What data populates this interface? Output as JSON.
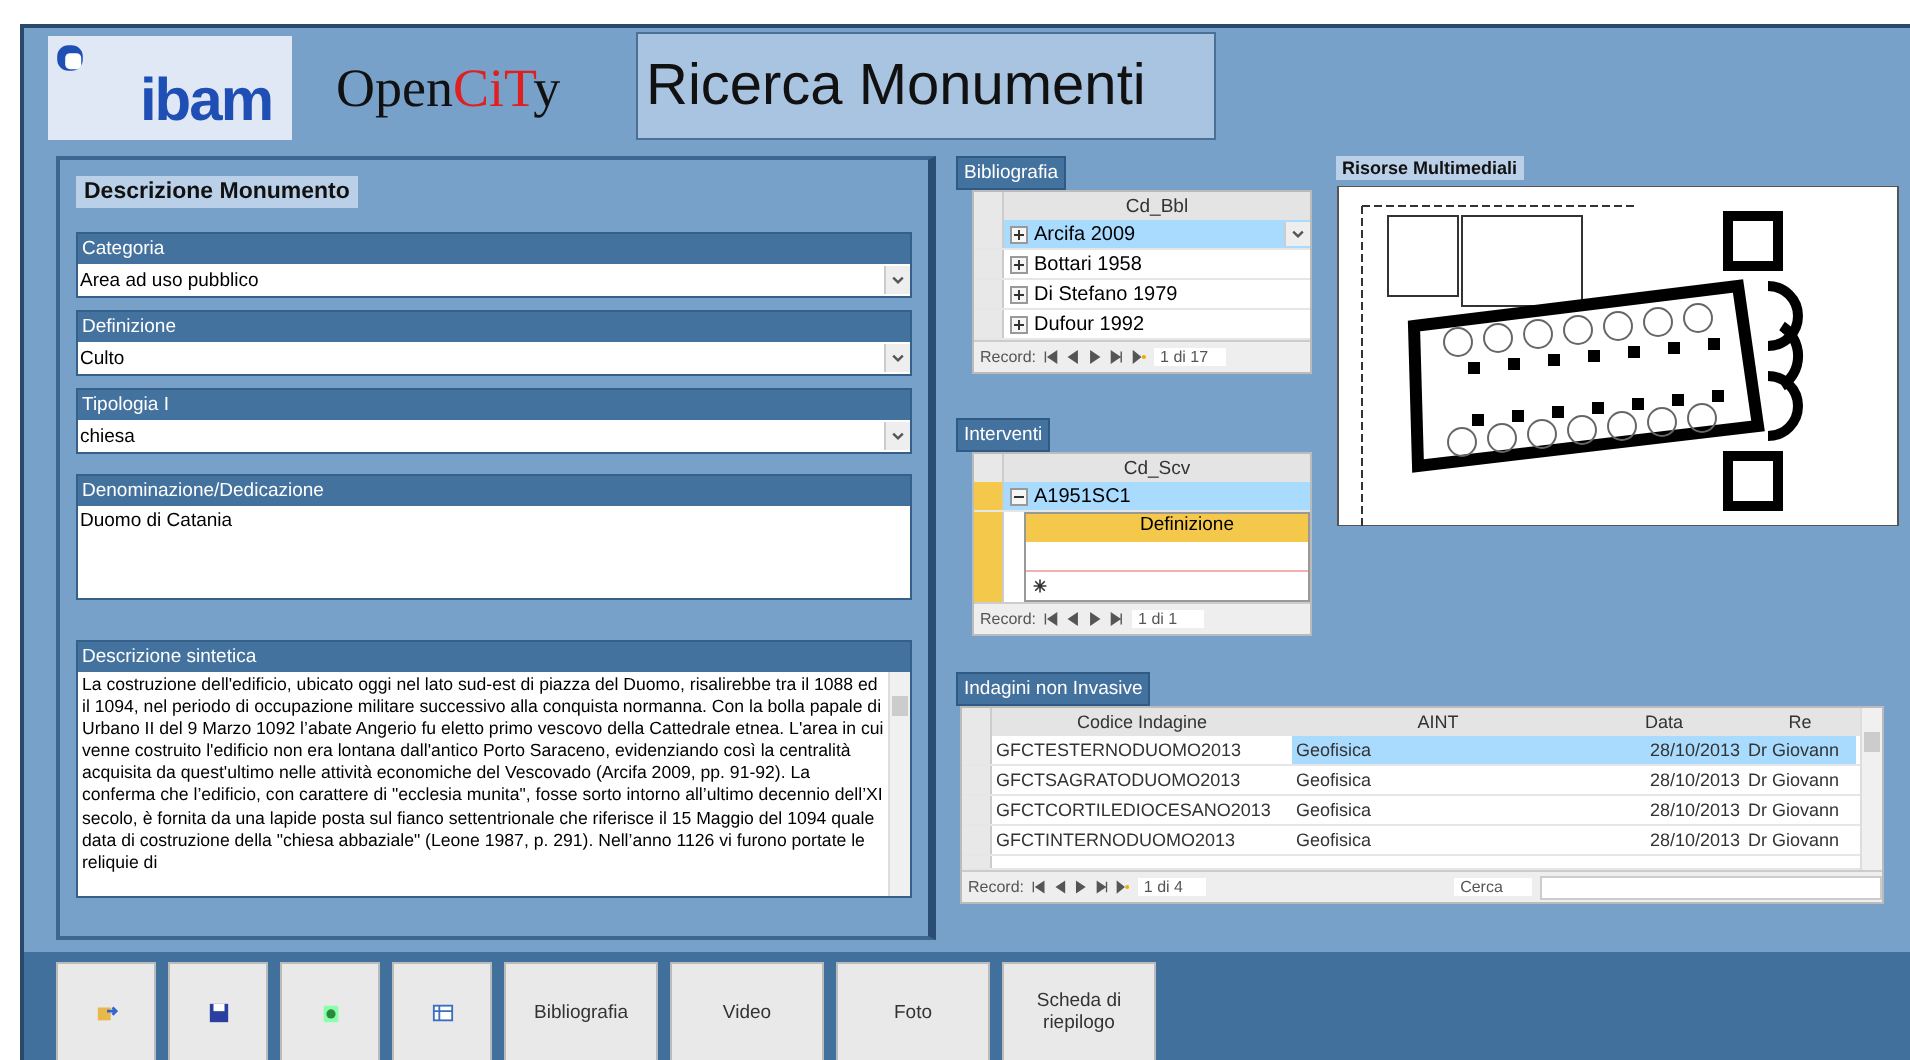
{
  "header": {
    "logo_text": "ibam",
    "app_name": [
      {
        "text": "Open",
        "accent": false
      },
      {
        "text": "CiT",
        "accent": true
      },
      {
        "text": "y",
        "accent": false
      }
    ],
    "title": "Ricerca Monumenti"
  },
  "description_panel": {
    "heading": "Descrizione Monumento",
    "fields": [
      {
        "kind": "combo",
        "label": "Categoria",
        "value": "Area ad uso pubblico"
      },
      {
        "kind": "combo",
        "label": "Definizione",
        "value": "Culto"
      },
      {
        "kind": "combo",
        "label": "Tipologia I",
        "value": "chiesa"
      },
      {
        "kind": "text",
        "label": "Denominazione/Dedicazione",
        "value": "Duomo di Catania"
      },
      {
        "kind": "memo",
        "label": "Descrizione sintetica",
        "value": "La costruzione dell'edificio, ubicato oggi nel lato sud-est di piazza del Duomo, risalirebbe tra il 1088 ed il 1094, nel periodo di occupazione militare successivo alla conquista normanna. Con la bolla papale di Urbano II del 9 Marzo 1092 l’abate Angerio fu eletto primo vescovo della Cattedrale etnea. L'area in cui venne costruito l'edificio non era lontana dall'antico Porto Saraceno, evidenziando così la centralità acquisita da quest'ultimo nelle attività economiche del Vescovado (Arcifa 2009, pp. 91-92). La conferma che l’edificio, con carattere di \"ecclesia munita\", fosse sorto intorno all’ultimo decennio dell’XI secolo, è fornita da una lapide posta sul fianco settentrionale che riferisce il 15 Maggio del 1094 quale data di costruzione della \"chiesa abbaziale\" (Leone 1987, p. 291). Nell’anno 1126 vi furono portate le reliquie di"
      }
    ]
  },
  "bibliografia": {
    "title": "Bibliografia",
    "column": "Cd_Bbl",
    "rows": [
      {
        "value": "Arcifa 2009",
        "selected": true
      },
      {
        "value": "Bottari 1958",
        "selected": false
      },
      {
        "value": "Di Stefano 1979",
        "selected": false
      },
      {
        "value": "Dufour 1992",
        "selected": false
      }
    ],
    "nav": {
      "label": "Record:",
      "position": "1 di 17"
    }
  },
  "interventi": {
    "title": "Interventi",
    "column": "Cd_Scv",
    "rows": [
      {
        "value": "A1951SC1",
        "selected": true,
        "expanded": true
      }
    ],
    "subcolumn": "Definizione",
    "nav": {
      "label": "Record:",
      "position": "1 di 1"
    }
  },
  "multimedia": {
    "title": "Risorse Multimediali"
  },
  "indagini": {
    "title": "Indagini non Invasive",
    "columns": [
      "Codice Indagine",
      "AINT",
      "Data",
      "Re"
    ],
    "rows": [
      {
        "cells": [
          "GFCTESTERNODUOMO2013",
          "Geofisica",
          "28/10/2013",
          "Dr Giovann"
        ],
        "selected": true
      },
      {
        "cells": [
          "GFCTSAGRATODUOMO2013",
          "Geofisica",
          "28/10/2013",
          "Dr Giovann"
        ],
        "selected": false
      },
      {
        "cells": [
          "GFCTCORTILEDIOCESANO2013",
          "Geofisica",
          "28/10/2013",
          "Dr Giovann"
        ],
        "selected": false
      },
      {
        "cells": [
          "GFCTINTERNODUOMO2013",
          "Geofisica",
          "28/10/2013",
          "Dr Giovann"
        ],
        "selected": false
      }
    ],
    "nav": {
      "label": "Record:",
      "position": "1 di 4",
      "search": "Cerca"
    }
  },
  "toolbar": [
    {
      "kind": "icon"
    },
    {
      "kind": "icon"
    },
    {
      "kind": "icon"
    },
    {
      "kind": "icon"
    },
    {
      "kind": "text",
      "label": "Bibliografia"
    },
    {
      "kind": "text",
      "label": "Video"
    },
    {
      "kind": "text",
      "label": "Foto"
    },
    {
      "kind": "text",
      "label": "Scheda di riepilogo"
    }
  ]
}
